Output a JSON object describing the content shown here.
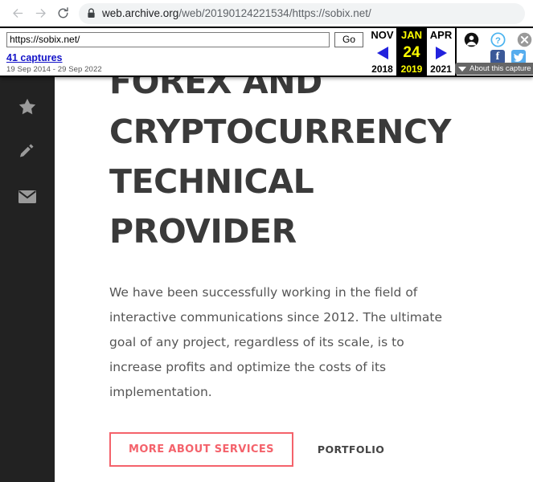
{
  "browser": {
    "back_icon": "back-arrow-icon",
    "forward_icon": "forward-arrow-icon",
    "reload_icon": "reload-icon",
    "lock_icon": "lock-icon",
    "url_host": "web.archive.org",
    "url_rest": "/web/20190124221534/https://sobix.net/"
  },
  "wayback": {
    "url_value": "https://sobix.net/",
    "url_placeholder": "https://sobix.net/",
    "go_label": "Go",
    "captures_label": "41 captures",
    "date_range": "19 Sep 2014 - 29 Sep 2022",
    "prev": {
      "month": "NOV",
      "year": "2018",
      "arrow_icon": "left-arrow-icon"
    },
    "current": {
      "month": "JAN",
      "day": "24",
      "year": "2019"
    },
    "next": {
      "month": "APR",
      "year": "2021",
      "arrow_icon": "right-arrow-icon"
    },
    "icons": {
      "account": "account-icon",
      "help": "help-icon",
      "close": "close-icon",
      "facebook": "facebook-icon",
      "facebook_glyph": "f",
      "twitter": "twitter-icon"
    },
    "about_label": "About this capture",
    "about_caret_icon": "chevron-down-icon",
    "colors": {
      "highlight_bg": "#000000",
      "highlight_text": "#ffff00",
      "link": "#1414c8"
    }
  },
  "site": {
    "sidebar": [
      {
        "name": "sidebar-item-favorites",
        "icon": "star-icon"
      },
      {
        "name": "sidebar-item-edit",
        "icon": "pencil-icon"
      },
      {
        "name": "sidebar-item-mail",
        "icon": "envelope-icon"
      }
    ],
    "hero": {
      "title": "FOREX AND CRYPTOCURRENCY TECHNICAL PROVIDER",
      "paragraph": "We have been successfully working in the field of interactive communications since 2012. The ultimate goal of any project, regardless of its scale, is to increase profits and optimize the costs of its implementation.",
      "primary_cta": "MORE ABOUT SERVICES",
      "secondary_cta": "PORTFOLIO"
    },
    "colors": {
      "accent": "#f4626b",
      "sidebar_bg": "#222222",
      "heading": "#3a3a3a"
    }
  }
}
